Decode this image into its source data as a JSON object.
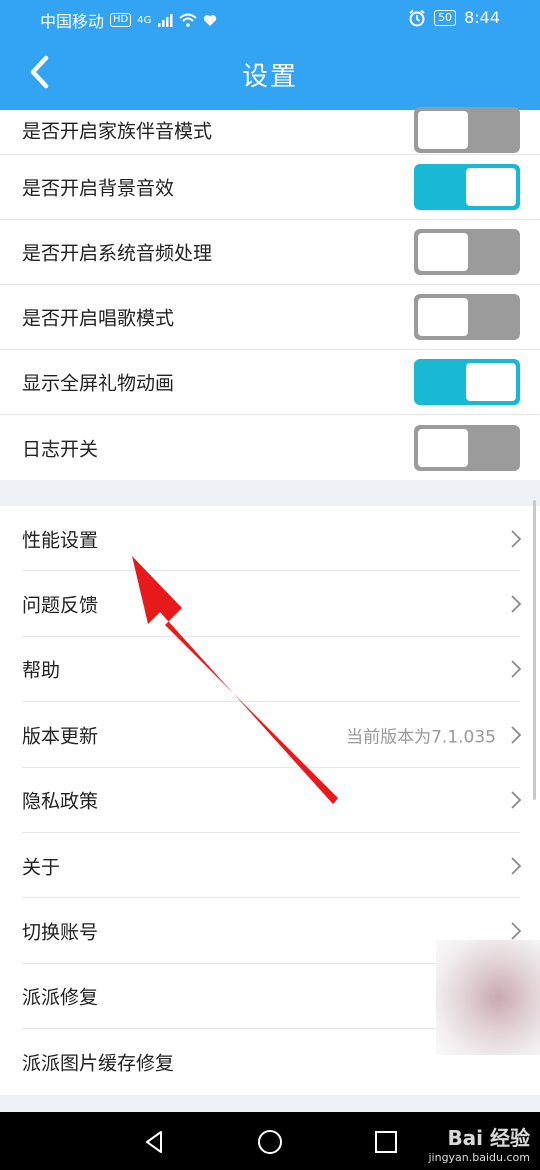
{
  "status_bar": {
    "carrier": "中国移动",
    "hd_badge": "HD",
    "network": "4G",
    "battery": "50",
    "time": "8:44"
  },
  "header": {
    "title": "设置",
    "back_icon": "chevron-left-icon"
  },
  "toggles": [
    {
      "label": "是否开启家族伴音模式",
      "on": false
    },
    {
      "label": "是否开启背景音效",
      "on": true
    },
    {
      "label": "是否开启系统音频处理",
      "on": false
    },
    {
      "label": "是否开启唱歌模式",
      "on": false
    },
    {
      "label": "显示全屏礼物动画",
      "on": true
    },
    {
      "label": "日志开关",
      "on": false
    }
  ],
  "nav_items": [
    {
      "label": "性能设置",
      "value": ""
    },
    {
      "label": "问题反馈",
      "value": ""
    },
    {
      "label": "帮助",
      "value": ""
    },
    {
      "label": "版本更新",
      "value": "当前版本为7.1.035"
    },
    {
      "label": "隐私政策",
      "value": ""
    },
    {
      "label": "关于",
      "value": ""
    },
    {
      "label": "切换账号",
      "value": ""
    },
    {
      "label": "派派修复",
      "value": ""
    },
    {
      "label": "派派图片缓存修复",
      "value": ""
    }
  ],
  "watermark": {
    "title": "Bai 经验",
    "url": "jingyan.baidu.com"
  },
  "colors": {
    "header": "#33a4f4",
    "toggle_on": "#17b9d5",
    "toggle_off": "#9b9b9b",
    "arrow": "#e8191b"
  }
}
